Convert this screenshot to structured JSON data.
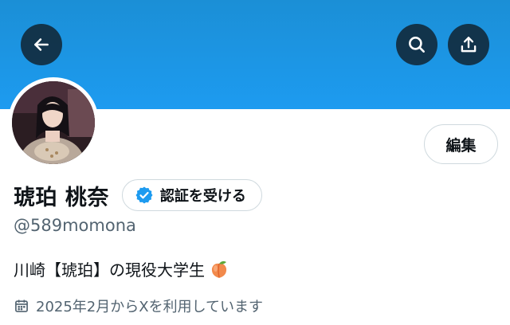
{
  "header": {
    "back_icon": "arrow-left-icon",
    "search_icon": "search-icon",
    "share_icon": "share-upload-icon",
    "banner_color": "#1d9bf0"
  },
  "profile": {
    "display_name": "琥珀 桃奈",
    "handle": "@589momona",
    "edit_label": "編集",
    "verify_label": "認証を受ける",
    "verify_icon": "verified-badge-icon",
    "verify_color": "#1d9bf0",
    "bio_text": "川崎【琥珀】の現役大学生",
    "bio_emoji": "peach-emoji",
    "joined_text": "2025年2月からXを利用しています",
    "joined_icon": "calendar-icon"
  }
}
